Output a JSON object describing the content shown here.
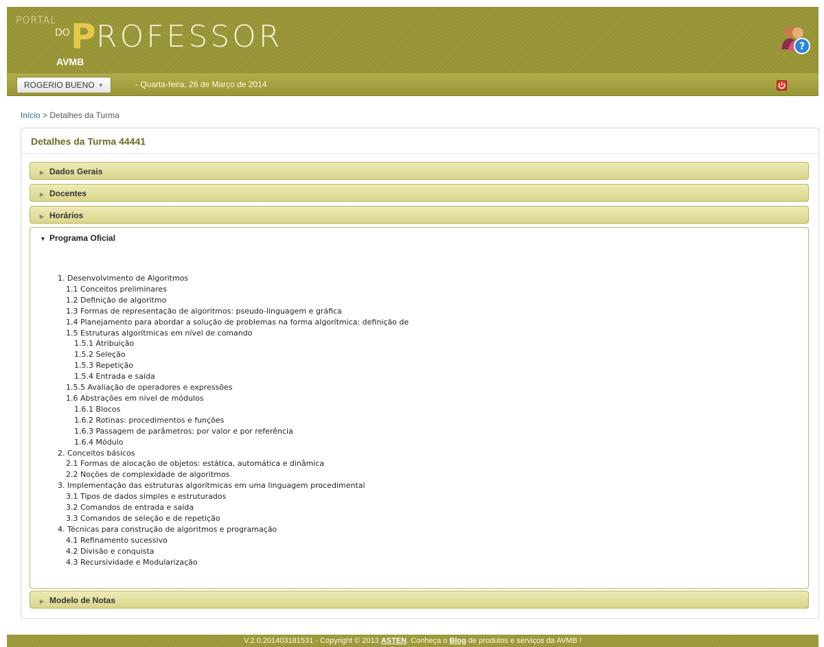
{
  "header": {
    "logo_portal": "PORTAL",
    "logo_do": "DO",
    "logo_p": "P",
    "logo_rest": "ROFESSOR",
    "logo_sub": "AVMB",
    "help_icon": "help-user-icon"
  },
  "userbar": {
    "user_name": "ROGERIO BUENO",
    "date": "-  Quarta-feira, 26 de Março de 2014",
    "logout_icon": "power-icon"
  },
  "breadcrumb": {
    "home": "Início",
    "separator": ">",
    "current": "Detalhes da Turma"
  },
  "panel": {
    "title": "Detalhes da Turma  44441",
    "sections": [
      {
        "label": "Dados Gerais"
      },
      {
        "label": "Docentes"
      },
      {
        "label": "Horários"
      },
      {
        "label": "Programa Oficial"
      },
      {
        "label": "Modelo de Notas"
      }
    ],
    "program_items": [
      "1. Desenvolvimento de Algoritmos",
      "1.1 Conceitos preliminares",
      "1.2 Definição de algoritmo",
      "1.3 Formas de representação de algoritmos: pseudo-linguagem e gráfica",
      "1.4 Planejamento para abordar a solução de problemas na forma algorítmica: definição de",
      "1.5 Estruturas algorítmicas em nível de comando",
      "1.5.1 Atribuição",
      "1.5.2 Seleção",
      "1.5.3 Repetição",
      "1.5.4 Entrada e saída",
      "1.5.5 Avaliação de operadores e expressões",
      "1.6 Abstrações em nível de módulos",
      "1.6.1 Blocos",
      "1.6.2 Rotinas: procedimentos e funções",
      "1.6.3 Passagem de parâmetros: por valor e por referência",
      "1.6.4 Módulo",
      "2. Conceitos básicos",
      "2.1 Formas de alocação de objetos: estática, automática e dinâmica",
      "2.2 Noções de complexidade de algoritmos",
      "3. Implementação das estruturas algorítmicas em uma linguagem procedimental",
      "3.1 Tipos de dados simples e estruturados",
      "3.2 Comandos de entrada e saída",
      "3.3 Comandos de seleção e de repetição",
      "4. Técnicas para construção de algoritmos e programação",
      "4.1 Refinamento sucessivo",
      "4.2 Divisão e conquista",
      "4.3 Recursividade e Modularização"
    ]
  },
  "footer": {
    "prefix": "V.2.0.201403181531 - Copyright © 2013 ",
    "asten": "ASTEN",
    "middle": ". Conheça o ",
    "blog": "Blog",
    "suffix": " de produtos e serviços da AVMB !"
  },
  "colors": {
    "brand_olive": "#9c9a3c",
    "accordion": "#d9d68c",
    "link_blue": "#2a6496",
    "logout_red": "#d7362d"
  }
}
